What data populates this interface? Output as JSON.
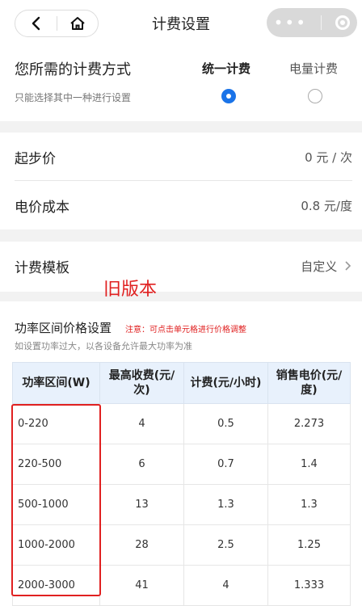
{
  "header": {
    "title": "计费设置"
  },
  "billing_mode": {
    "title": "您所需的计费方式",
    "hint": "只能选择其中一种进行设置",
    "options": [
      {
        "label": "统一计费",
        "selected": true
      },
      {
        "label": "电量计费",
        "selected": false
      }
    ]
  },
  "pricing": {
    "start_price_label": "起步价",
    "start_price_value": "0 元 / 次",
    "cost_label": "电价成本",
    "cost_value": "0.8 元/度"
  },
  "template": {
    "label": "计费模板",
    "value": "自定义"
  },
  "annotation": {
    "text": "旧版本"
  },
  "power_price": {
    "title": "功率区间价格设置",
    "note": "注意：可点击单元格进行价格调整",
    "subtitle": "如设置功率过大，以各设备允许最大功率为准",
    "columns": [
      "功率区间(W)",
      "最高收费(元/次)",
      "计费(元/小时)",
      "销售电价(元/度)"
    ],
    "rows": [
      {
        "range": "0-220",
        "max": "4",
        "rate": "0.5",
        "price": "2.273"
      },
      {
        "range": "220-500",
        "max": "6",
        "rate": "0.7",
        "price": "1.4"
      },
      {
        "range": "500-1000",
        "max": "13",
        "rate": "1.3",
        "price": "1.3"
      },
      {
        "range": "1000-2000",
        "max": "28",
        "rate": "2.5",
        "price": "1.25"
      },
      {
        "range": "2000-3000",
        "max": "41",
        "rate": "4",
        "price": "1.333"
      }
    ]
  }
}
